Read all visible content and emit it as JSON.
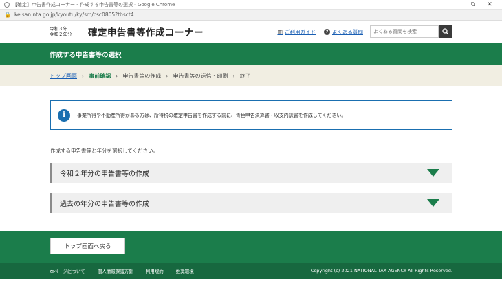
{
  "browser": {
    "window_title": "【確定】申告書作成コーナー - 作成する申告書等の選択 - Google Chrome",
    "url": "keisan.nta.go.jp/kyoutu/ky/sm/csc0805?tbsct4"
  },
  "header": {
    "era_line1": "令和３年",
    "era_line2": "令和２年分",
    "title": "確定申告書等作成コーナー",
    "guide_link": "ご利用ガイド",
    "faq_link": "よくある質問",
    "search_placeholder": "よくある質問を検索"
  },
  "band": {
    "heading": "作成する申告書等の選択"
  },
  "breadcrumb": {
    "items": [
      "トップ画面",
      "事前確認",
      "申告書等の作成",
      "申告書等の送信・印刷",
      "終了"
    ]
  },
  "notice": {
    "text": "事業所得や不動産所得がある方は、所得税の確定申告書を作成する前に、青色申告決算書・収支内訳書を作成してください。"
  },
  "main": {
    "intro": "作成する申告書等と年分を選択してください。",
    "accordion": [
      {
        "label": "令和２年分の申告書等の作成"
      },
      {
        "label": "過去の年分の申告書等の作成"
      }
    ],
    "back_button": "トップ画面へ戻る"
  },
  "footer": {
    "links": [
      "本ページについて",
      "個人情報保護方針",
      "利用規約",
      "推奨環境"
    ],
    "copyright": "Copyright (c) 2021 NATIONAL TAX AGENCY All Rights Reserved."
  },
  "colors": {
    "brand_green": "#1b7d4b",
    "info_blue": "#1a6fb0",
    "breadcrumb_bg": "#f1eee2"
  }
}
